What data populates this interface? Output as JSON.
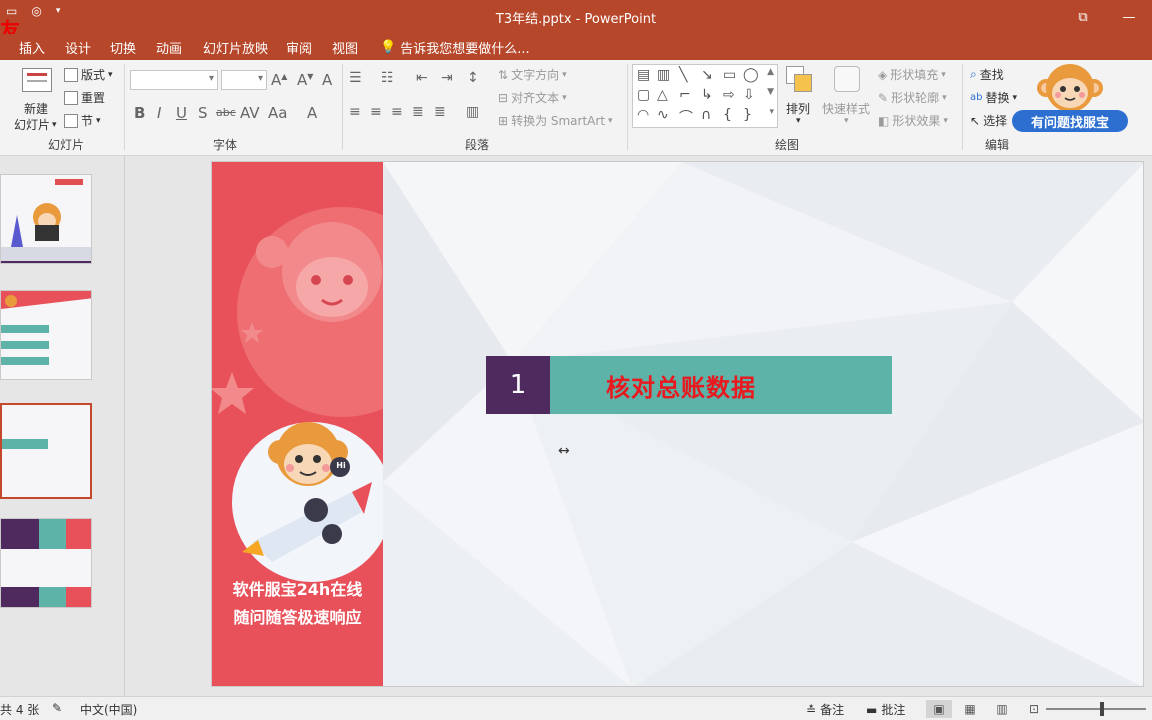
{
  "window": {
    "title": "T3年结.pptx - PowerPoint",
    "corner_char": "友",
    "restore_glyph": "⧉",
    "minimize_glyph": "—"
  },
  "menu": {
    "tabs": [
      "插入",
      "设计",
      "切换",
      "动画",
      "幻灯片放映",
      "审阅",
      "视图"
    ],
    "tell_me": "告诉我您想要做什么..."
  },
  "ribbon": {
    "slides_group": {
      "label": "幻灯片",
      "new_slide": "新建",
      "new_slide_2": "幻灯片",
      "layout": "版式",
      "reset": "重置",
      "section": "节"
    },
    "font_group": {
      "label": "字体"
    },
    "paragraph_group": {
      "label": "段落",
      "text_direction": "文字方向",
      "align_text": "对齐文本",
      "convert_smartart": "转换为 SmartArt"
    },
    "drawing_group": {
      "label": "绘图",
      "arrange": "排列",
      "quick_styles": "快速样式",
      "shape_fill": "形状填充",
      "shape_outline": "形状轮廓",
      "shape_effects": "形状效果"
    },
    "editing_group": {
      "label": "编辑",
      "find": "查找",
      "replace": "替换",
      "select": "选择"
    },
    "assistant": "有问题找服宝"
  },
  "slide": {
    "slogan_1": "软件服宝24h在线",
    "slogan_2": "随问随答极速响应",
    "bubble": "Hi",
    "number": "1",
    "heading": "核对总账数据"
  },
  "status": {
    "slide_count": "共 4 张",
    "language": "中文(中国)",
    "notes": "备注",
    "comments": "批注"
  },
  "colors": {
    "title_bar": "#b7472a",
    "left_panel": "#e8515a",
    "heading_bar": "#5db3a7",
    "number_box": "#4e2a5e",
    "heading_text": "#e8191f"
  }
}
